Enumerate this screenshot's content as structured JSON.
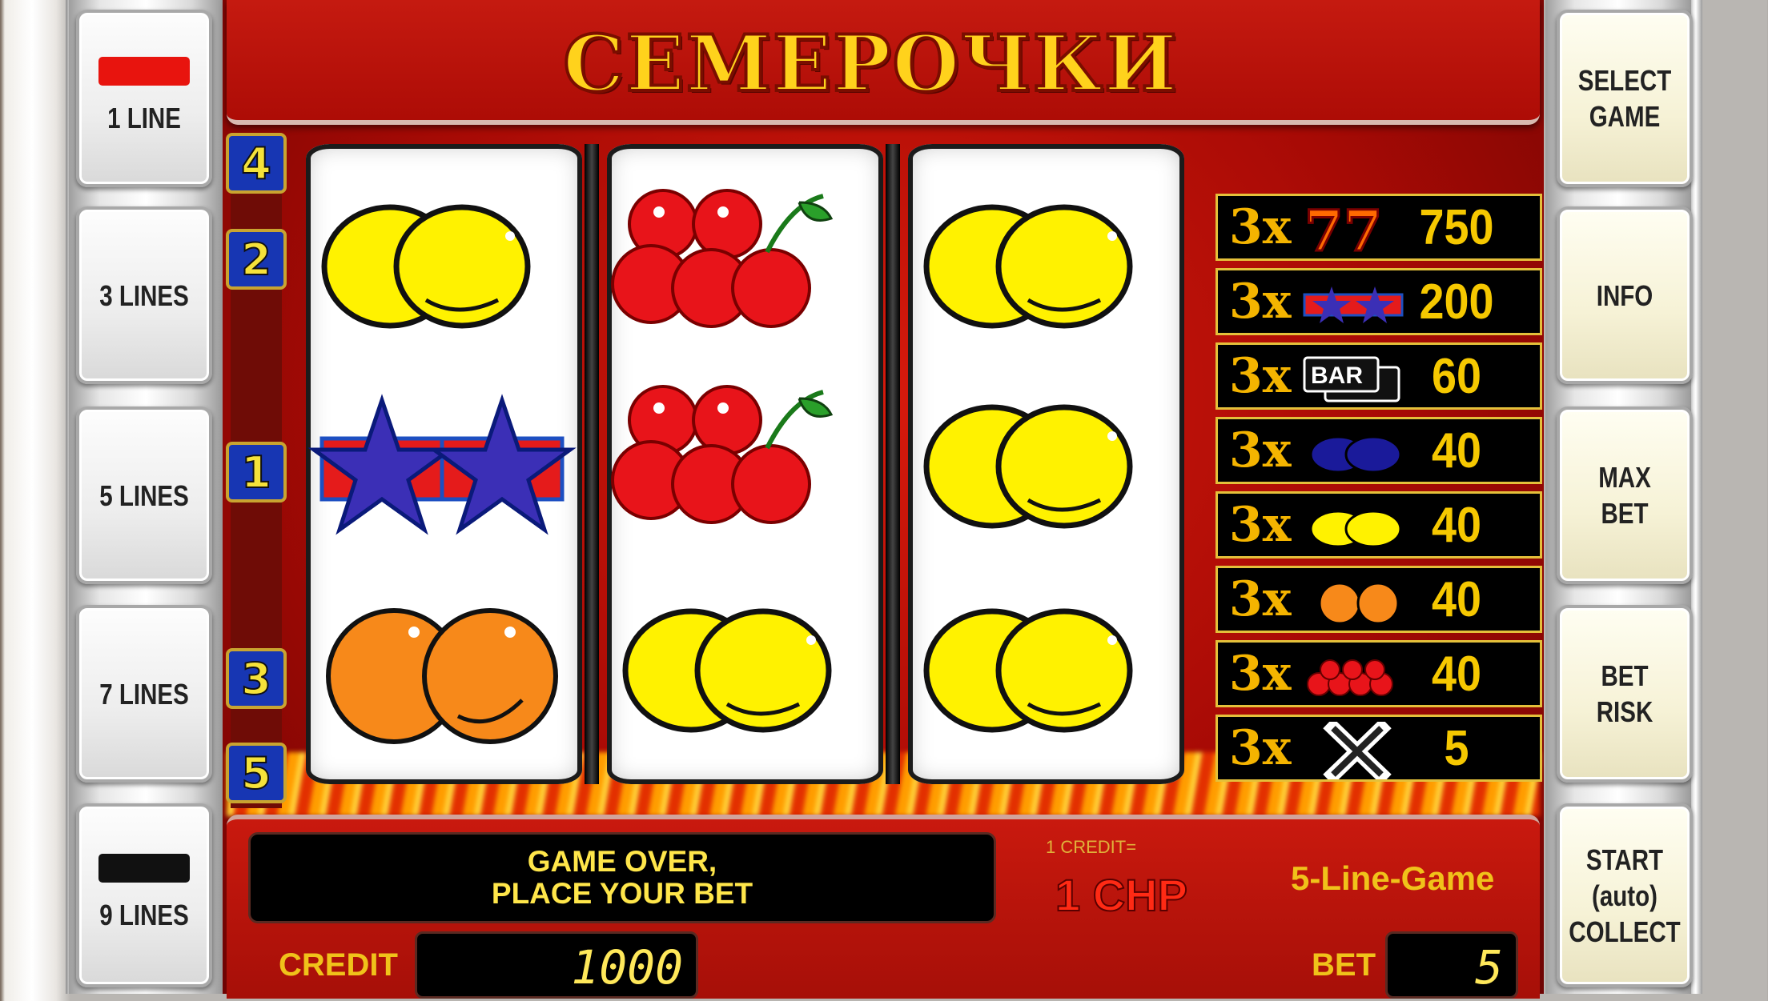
{
  "title": "СЕМЕРОЧКИ",
  "left_buttons": [
    {
      "label": "1 LINE",
      "indicator": "#e8140e"
    },
    {
      "label": "3 LINES"
    },
    {
      "label": "5 LINES"
    },
    {
      "label": "7 LINES"
    },
    {
      "label": "9 LINES",
      "indicator": "#111111"
    }
  ],
  "right_buttons": [
    {
      "label": "SELECT\nGAME"
    },
    {
      "label": "INFO"
    },
    {
      "label": "MAX\nBET"
    },
    {
      "label": "BET\nRISK"
    },
    {
      "label": "START\n(auto)\nCOLLECT"
    }
  ],
  "line_numbers": [
    "4",
    "2",
    "1",
    "3",
    "5"
  ],
  "reels": [
    [
      "lemon-pair-icon",
      "star-pair-icon",
      "orange-pair-icon"
    ],
    [
      "cherry-cluster-icon",
      "cherry-cluster-icon",
      "lemon-pair-icon"
    ],
    [
      "lemon-pair-icon",
      "lemon-pair-icon",
      "lemon-pair-icon"
    ]
  ],
  "paytable": [
    {
      "multiplier": "3x",
      "symbol": "seven-icon",
      "payout": "750"
    },
    {
      "multiplier": "3x",
      "symbol": "star-icon",
      "payout": "200"
    },
    {
      "multiplier": "3x",
      "symbol": "bar-icon",
      "payout": "60",
      "symbol_text": "BAR"
    },
    {
      "multiplier": "3x",
      "symbol": "plum-icon",
      "payout": "40"
    },
    {
      "multiplier": "3x",
      "symbol": "lemon-icon",
      "payout": "40"
    },
    {
      "multiplier": "3x",
      "symbol": "orange-icon",
      "payout": "40"
    },
    {
      "multiplier": "3x",
      "symbol": "cherry-icon",
      "payout": "40"
    },
    {
      "multiplier": "3x",
      "symbol": "x-icon",
      "payout": "5"
    }
  ],
  "message": {
    "line1": "GAME OVER,",
    "line2": "PLACE YOUR BET"
  },
  "credit_rate": {
    "label": "1 CREDIT=",
    "value": "1 CHP"
  },
  "game_mode": "5-Line-Game",
  "credit": {
    "label": "CREDIT",
    "value": "1000"
  },
  "bet": {
    "label": "BET",
    "value": "5"
  },
  "colors": {
    "panel_red": "#c51a10",
    "gold": "#f0c21a",
    "lcd_yellow": "#ffe85a"
  }
}
